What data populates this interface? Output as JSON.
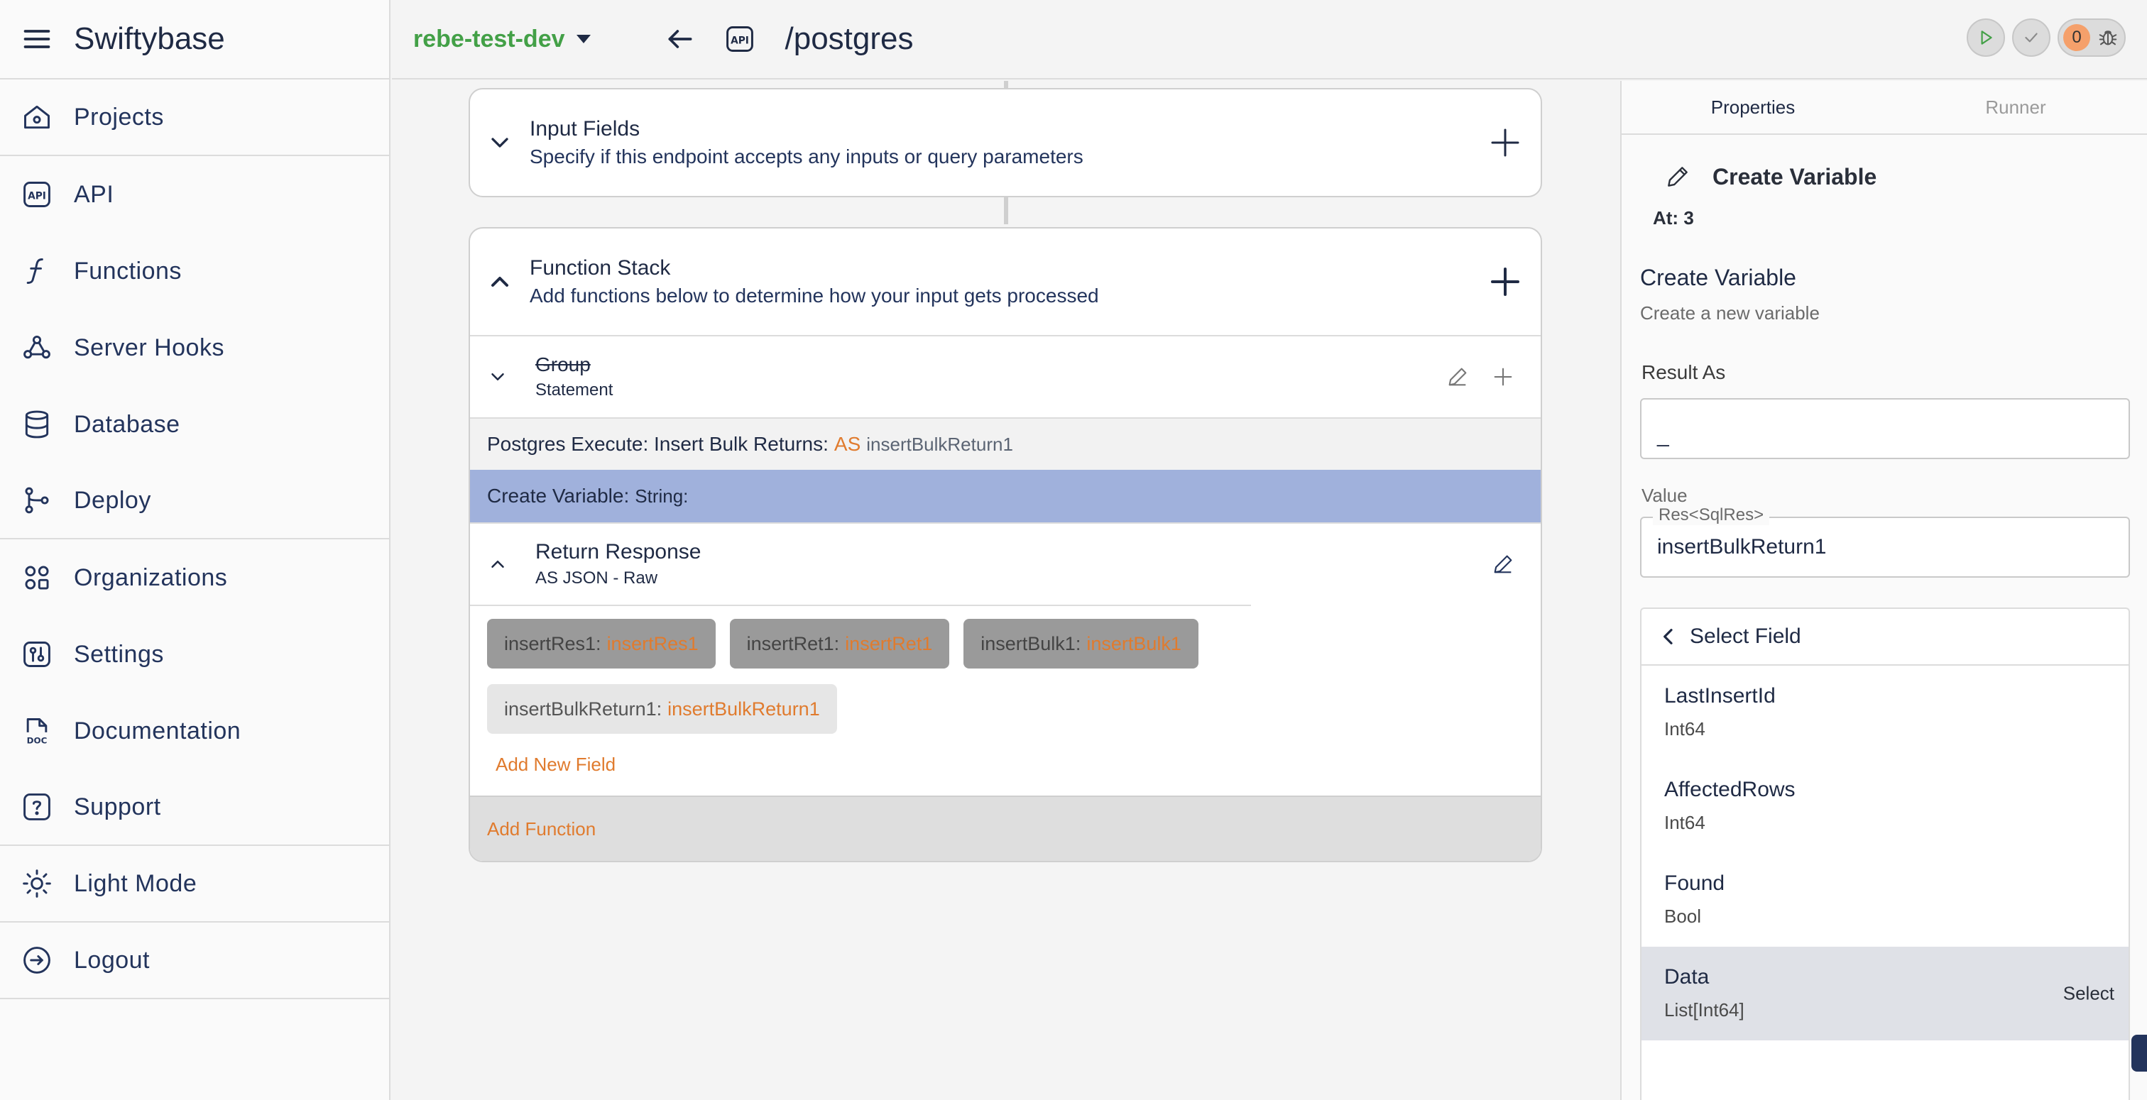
{
  "app": {
    "title": "Swiftybase"
  },
  "sidebar": {
    "items": [
      {
        "label": "Projects",
        "icon": "home-icon"
      },
      {
        "label": "API",
        "icon": "api-icon"
      },
      {
        "label": "Functions",
        "icon": "function-icon"
      },
      {
        "label": "Server Hooks",
        "icon": "webhook-icon"
      },
      {
        "label": "Database",
        "icon": "database-icon"
      },
      {
        "label": "Deploy",
        "icon": "deploy-icon"
      },
      {
        "label": "Organizations",
        "icon": "organizations-icon"
      },
      {
        "label": "Settings",
        "icon": "settings-icon"
      },
      {
        "label": "Documentation",
        "icon": "doc-icon"
      },
      {
        "label": "Support",
        "icon": "help-icon"
      },
      {
        "label": "Light Mode",
        "icon": "sun-icon"
      },
      {
        "label": "Logout",
        "icon": "logout-icon"
      }
    ]
  },
  "topbar": {
    "environment": "rebe-test-dev",
    "path": "/postgres",
    "debug_count": "0",
    "colors": {
      "environment": "#43a047",
      "accent": "#e07b2e"
    }
  },
  "input_fields": {
    "title": "Input Fields",
    "subtitle": "Specify if this endpoint accepts any inputs or query parameters"
  },
  "function_stack": {
    "title": "Function Stack",
    "subtitle": "Add functions below to determine how your input gets processed",
    "group": {
      "title": "Group",
      "subtitle": "Statement"
    },
    "exec": {
      "label": "Postgres Execute: Insert Bulk Returns:",
      "as": "AS",
      "var": "insertBulkReturn1"
    },
    "create_var": {
      "label": "Create Variable:",
      "type": "String:"
    },
    "response": {
      "title": "Return Response",
      "subtitle": "AS JSON - Raw"
    },
    "chips": [
      {
        "key": "insertRes1:",
        "value": "insertRes1"
      },
      {
        "key": "insertRet1:",
        "value": "insertRet1"
      },
      {
        "key": "insertBulk1:",
        "value": "insertBulk1"
      },
      {
        "key": "insertBulkReturn1:",
        "value": "insertBulkReturn1"
      }
    ],
    "add_field": "Add New Field",
    "add_function": "Add Function"
  },
  "panel": {
    "tabs": [
      "Properties",
      "Runner"
    ],
    "header": "Create Variable",
    "at": "At: 3",
    "section_title": "Create Variable",
    "section_desc": "Create a new variable",
    "result_label": "Result As",
    "result_value": "_",
    "value_label": "Value",
    "value_type": "Res<SqlRes>",
    "value_input": "insertBulkReturn1",
    "dropdown": {
      "title": "Select Field",
      "items": [
        {
          "name": "LastInsertId",
          "type": "Int64"
        },
        {
          "name": "AffectedRows",
          "type": "Int64"
        },
        {
          "name": "Found",
          "type": "Bool"
        },
        {
          "name": "Data",
          "type": "List[Int64]"
        }
      ],
      "select_label": "Select"
    }
  }
}
